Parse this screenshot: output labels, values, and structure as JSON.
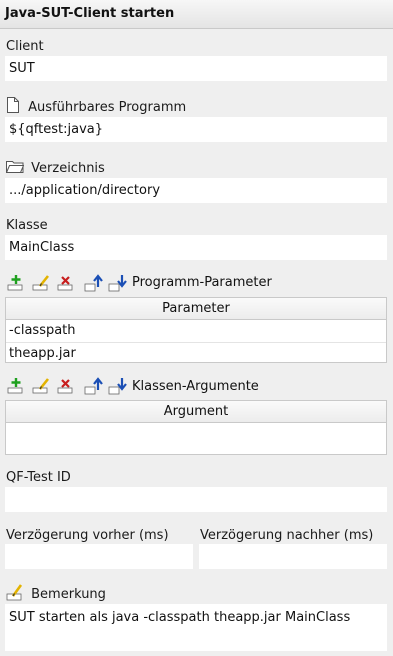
{
  "title": "Java-SUT-Client starten",
  "client": {
    "label": "Client",
    "value": "SUT"
  },
  "program": {
    "label": "Ausführbares Programm",
    "value": "${qftest:java}",
    "icon": "file-icon"
  },
  "directory": {
    "label": "Verzeichnis",
    "value": ".../application/directory",
    "icon": "folder-icon"
  },
  "klasse": {
    "label": "Klasse",
    "value": "MainClass"
  },
  "program_params": {
    "label": "Programm-Parameter",
    "column": "Parameter",
    "rows": [
      "-classpath",
      "theapp.jar"
    ]
  },
  "class_args": {
    "label": "Klassen-Argumente",
    "column": "Argument",
    "rows": []
  },
  "qf_id": {
    "label": "QF-Test ID",
    "value": ""
  },
  "delay_before": {
    "label": "Verzögerung vorher (ms)",
    "value": ""
  },
  "delay_after": {
    "label": "Verzögerung nachher (ms)",
    "value": ""
  },
  "comment": {
    "label": "Bemerkung",
    "value": "SUT starten als java -classpath theapp.jar MainClass"
  },
  "toolbar_icons": [
    "add-icon",
    "edit-icon",
    "delete-icon",
    "move-up-icon",
    "move-down-icon"
  ],
  "colors": {
    "add": "#1fa01f",
    "edit": "#e3b300",
    "delete": "#c81e1e",
    "arrow": "#1b4fb5"
  }
}
